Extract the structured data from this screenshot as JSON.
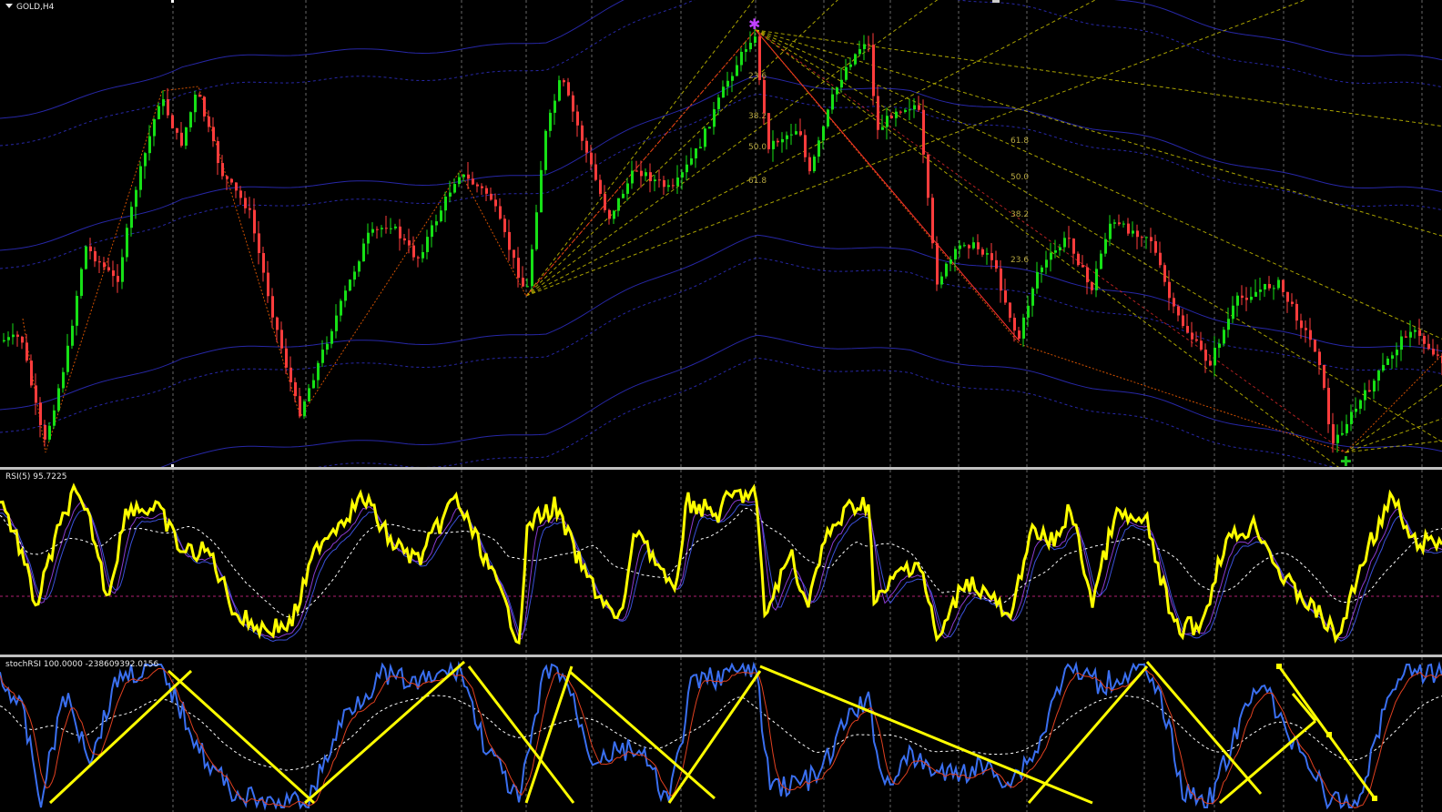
{
  "main_chart": {
    "title": "GOLD,H4",
    "fib_levels_left": [
      "23.6",
      "38.2",
      "50.0",
      "61.8"
    ],
    "fib_levels_right": [
      "61.8",
      "50.0",
      "38.2",
      "23.6"
    ],
    "colors": {
      "bull": "#16e016",
      "bear": "#ff3c3c",
      "fan": "#c8c000",
      "envelope": "#2b2bb8",
      "zigzag": "#d05000"
    }
  },
  "rsi_panel": {
    "label": "RSI(5) 95.7225",
    "colors": {
      "rsi": "#ffff00",
      "signal": "#8a3bd0",
      "ma": "#ffffff"
    }
  },
  "stoch_panel": {
    "label": "stochRSI 100.0000 -238609392.0156",
    "colors": {
      "k": "#3a6ff0",
      "d": "#e04020",
      "trend": "#ffff00"
    }
  }
}
